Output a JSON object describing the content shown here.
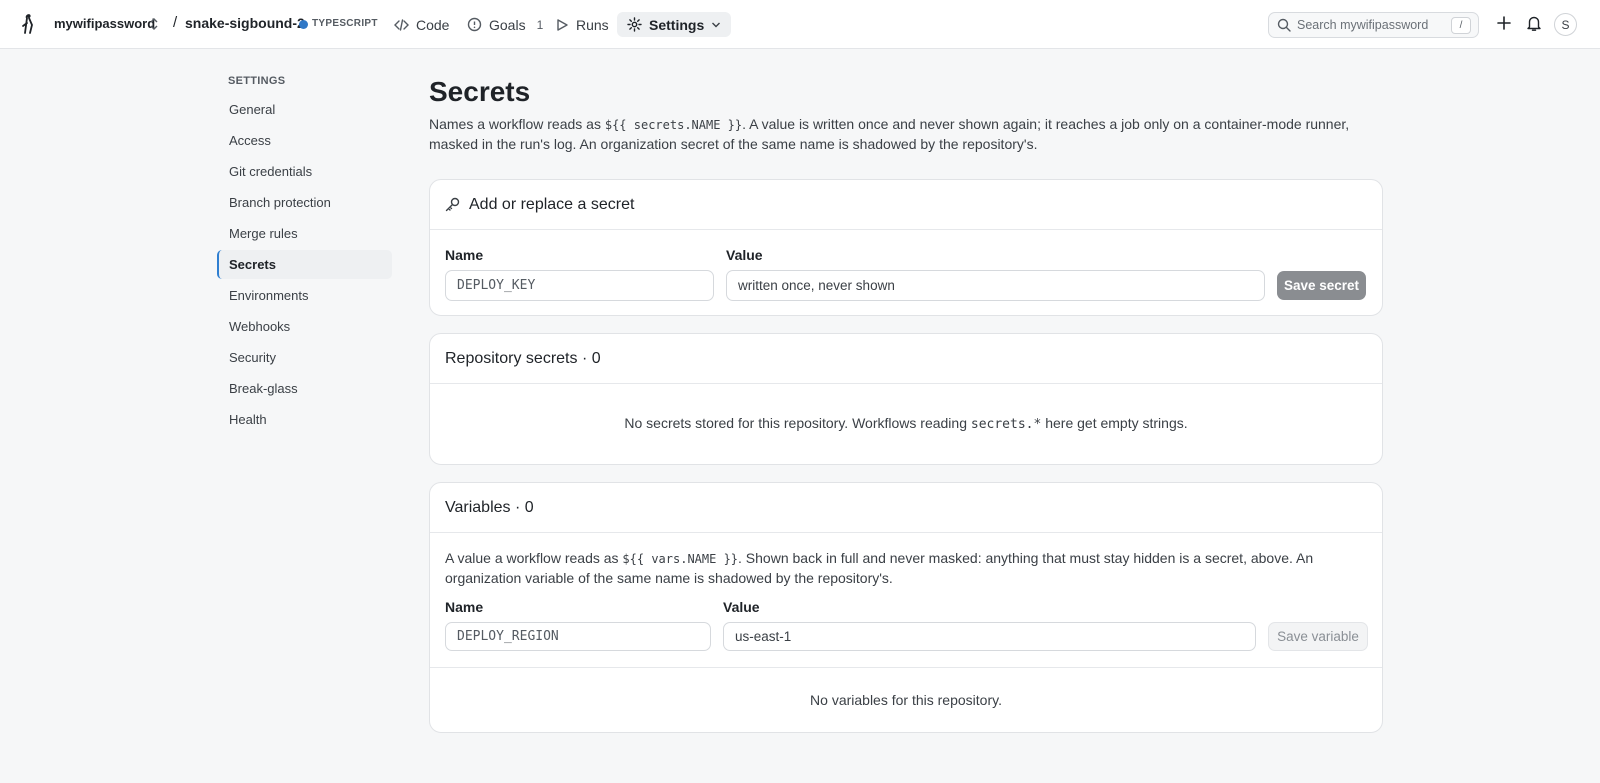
{
  "topbar": {
    "org": "mywifipassword",
    "repo": "snake-sigbound-2",
    "language": "TYPESCRIPT",
    "nav": [
      {
        "label": "Code",
        "icon": "code-icon"
      },
      {
        "label": "Goals",
        "count": "1",
        "icon": "circle-dot-icon"
      },
      {
        "label": "Runs",
        "icon": "play-icon"
      },
      {
        "label": "Settings",
        "icon": "gear-icon",
        "active": true
      }
    ],
    "search_placeholder": "Search mywifipassword",
    "search_shortcut": "/",
    "avatar_initial": "S"
  },
  "sidebar": {
    "heading": "SETTINGS",
    "items": [
      {
        "label": "General"
      },
      {
        "label": "Access"
      },
      {
        "label": "Git credentials"
      },
      {
        "label": "Branch protection"
      },
      {
        "label": "Merge rules"
      },
      {
        "label": "Secrets",
        "active": true
      },
      {
        "label": "Environments"
      },
      {
        "label": "Webhooks"
      },
      {
        "label": "Security"
      },
      {
        "label": "Break-glass"
      },
      {
        "label": "Health"
      }
    ]
  },
  "main": {
    "title": "Secrets",
    "desc_pre": "Names a workflow reads as ",
    "desc_code": "${{ secrets.NAME }}",
    "desc_post": ". A value is written once and never shown again; it reaches a job only on a container-mode runner, masked in the run's log. An organization secret of the same name is shadowed by the repository's.",
    "add_card": {
      "title": "Add or replace a secret",
      "name_label": "Name",
      "name_placeholder": "DEPLOY_KEY",
      "value_label": "Value",
      "value_placeholder": "written once, never shown",
      "save_label": "Save secret"
    },
    "repo_secrets": {
      "title": "Repository secrets · 0",
      "empty_pre": "No secrets stored for this repository. Workflows reading ",
      "empty_code": "secrets.*",
      "empty_post": " here get empty strings."
    },
    "variables": {
      "title": "Variables · 0",
      "desc_pre": "A value a workflow reads as ",
      "desc_code": "${{ vars.NAME }}",
      "desc_post": ". Shown back in full and never masked: anything that must stay hidden is a secret, above. An organization variable of the same name is shadowed by the repository's.",
      "name_label": "Name",
      "name_placeholder": "DEPLOY_REGION",
      "value_label": "Value",
      "value_placeholder": "us-east-1",
      "save_label": "Save variable",
      "empty": "No variables for this repository."
    }
  }
}
